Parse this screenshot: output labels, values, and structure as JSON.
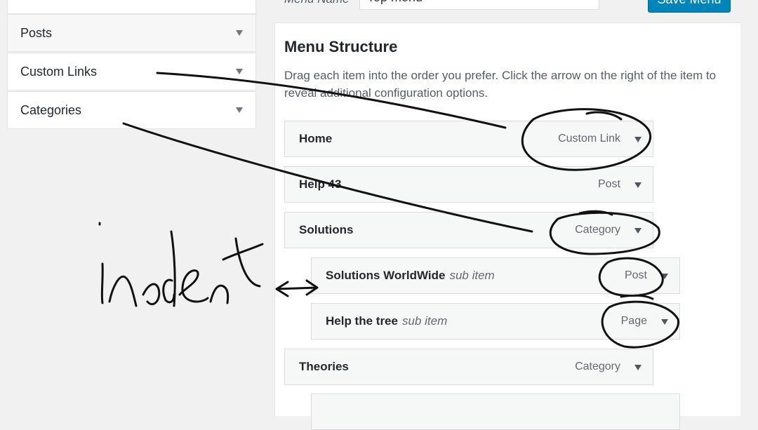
{
  "left_panel": {
    "items": [
      {
        "label": "Posts"
      },
      {
        "label": "Custom Links"
      },
      {
        "label": "Categories"
      }
    ]
  },
  "header": {
    "menu_name_label": "Menu Name",
    "menu_name_value": "Top menu",
    "save_label": "Save Menu"
  },
  "structure": {
    "title": "Menu Structure",
    "help": "Drag each item into the order you prefer. Click the arrow on the right of the item to reveal additional configuration options.",
    "items": [
      {
        "title": "Home",
        "sub": "",
        "type": "Custom Link"
      },
      {
        "title": "Help 43",
        "sub": "",
        "type": "Post"
      },
      {
        "title": "Solutions",
        "sub": "",
        "type": "Category"
      },
      {
        "title": "Solutions WorldWide",
        "sub": "sub item",
        "type": "Post"
      },
      {
        "title": "Help the tree",
        "sub": "sub item",
        "type": "Page"
      },
      {
        "title": "Theories",
        "sub": "",
        "type": "Category"
      }
    ]
  },
  "annotation": {
    "handwriting": "indent",
    "ink_color": "#111111"
  }
}
